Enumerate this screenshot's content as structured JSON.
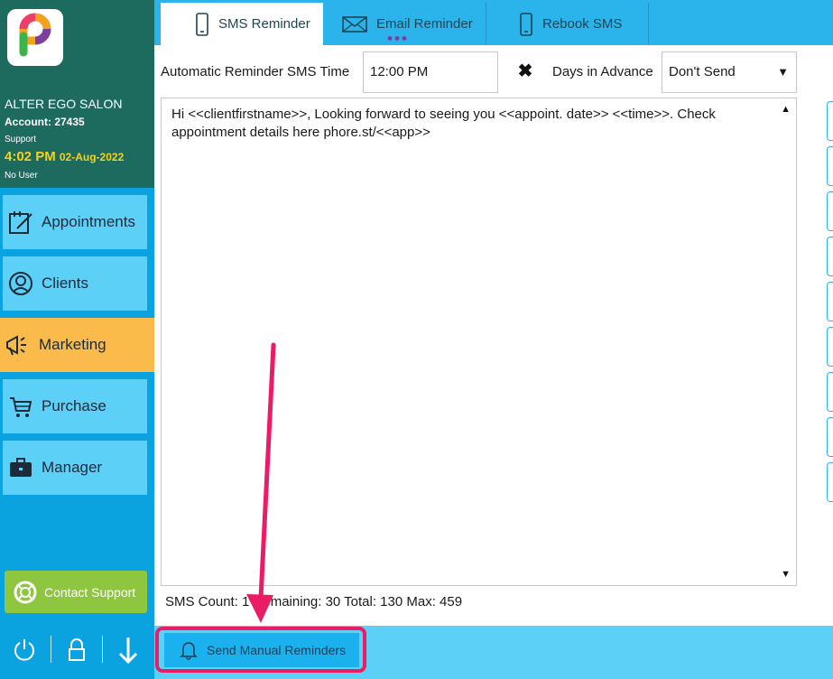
{
  "sidebar": {
    "salon_name": "ALTER EGO SALON",
    "account": "Account: 27435",
    "support_label": "Support",
    "time": "4:02 PM",
    "date": "02-Aug-2022",
    "user": "No User",
    "items": [
      {
        "label": "Appointments",
        "icon": "calendar-edit-icon"
      },
      {
        "label": "Clients",
        "icon": "client-icon"
      },
      {
        "label": "Marketing",
        "icon": "megaphone-icon"
      },
      {
        "label": "Purchase",
        "icon": "cart-icon"
      },
      {
        "label": "Manager",
        "icon": "briefcase-icon"
      }
    ],
    "active_item": "Marketing",
    "contact_support": "Contact Support",
    "bottom_icons": [
      "power-icon",
      "lock-icon",
      "down-arrow-icon"
    ]
  },
  "tabs": [
    {
      "label": "SMS Reminder",
      "icon": "phone-icon",
      "active": true
    },
    {
      "label": "Email Reminder",
      "icon": "envelope-icon",
      "active": false
    },
    {
      "label": "Rebook SMS",
      "icon": "phone-icon",
      "active": false
    }
  ],
  "settings": {
    "time_label": "Automatic Reminder SMS Time",
    "time_value": "12:00 PM",
    "days_label": "Days in Advance",
    "days_value": "Don't Send"
  },
  "message": {
    "text": "Hi <<clientfirstname>>, Looking forward to seeing you <<appoint. date>> <<time>>. Check appointment details here phore.st/<<app>>"
  },
  "sms_count": "SMS Count: 1 Remaining: 30 Total: 130 Max: 459",
  "send_button": "Send Manual Reminders",
  "colors": {
    "sidebar": "#0aa3df",
    "sidebar_header": "#1d6a5f",
    "nav_item": "#5dd0f7",
    "nav_active": "#fbbb4a",
    "contact": "#8ec63f",
    "highlight": "#ec1b66"
  }
}
